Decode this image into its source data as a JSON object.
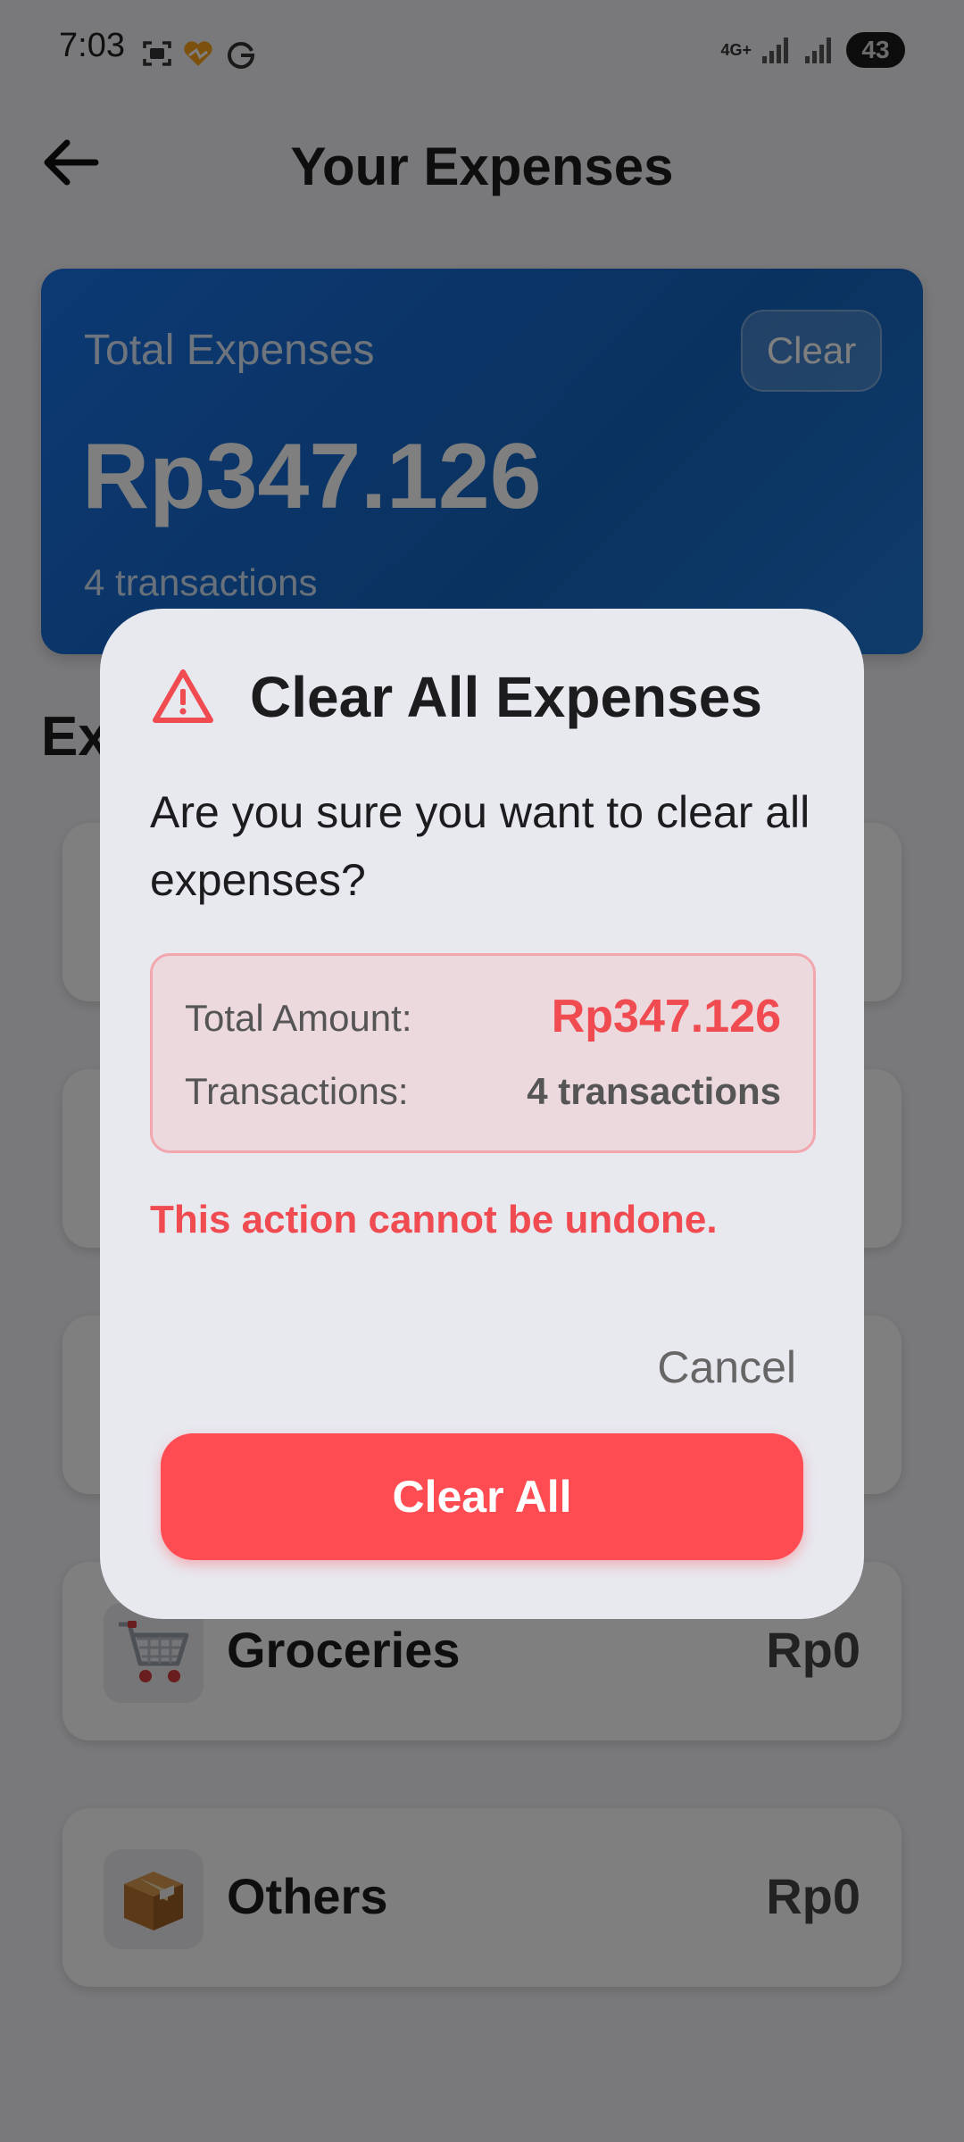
{
  "status_bar": {
    "time": "7:03",
    "network": "4G+",
    "battery": "43"
  },
  "app_bar": {
    "title": "Your Expenses"
  },
  "summary": {
    "label": "Total Expenses",
    "amount": "Rp347.126",
    "count": "4 transactions",
    "clear_label": "Clear"
  },
  "section": {
    "title": "Ex"
  },
  "categories": [
    {
      "name": "Groceries",
      "amount": "Rp0",
      "icon": "shopping-cart-icon"
    },
    {
      "name": "Others",
      "amount": "Rp0",
      "icon": "package-box-icon"
    }
  ],
  "dialog": {
    "title": "Clear All Expenses",
    "message": "Are you sure you want to clear all expenses?",
    "total_label": "Total Amount:",
    "total_value": "Rp347.126",
    "tx_label": "Transactions:",
    "tx_value": "4 transactions",
    "warning": "This action cannot be undone.",
    "cancel_label": "Cancel",
    "confirm_label": "Clear All"
  },
  "colors": {
    "accent_red": "#ff4c52",
    "card_blue": "#1a73e8",
    "dialog_bg": "#e8e8ef"
  }
}
